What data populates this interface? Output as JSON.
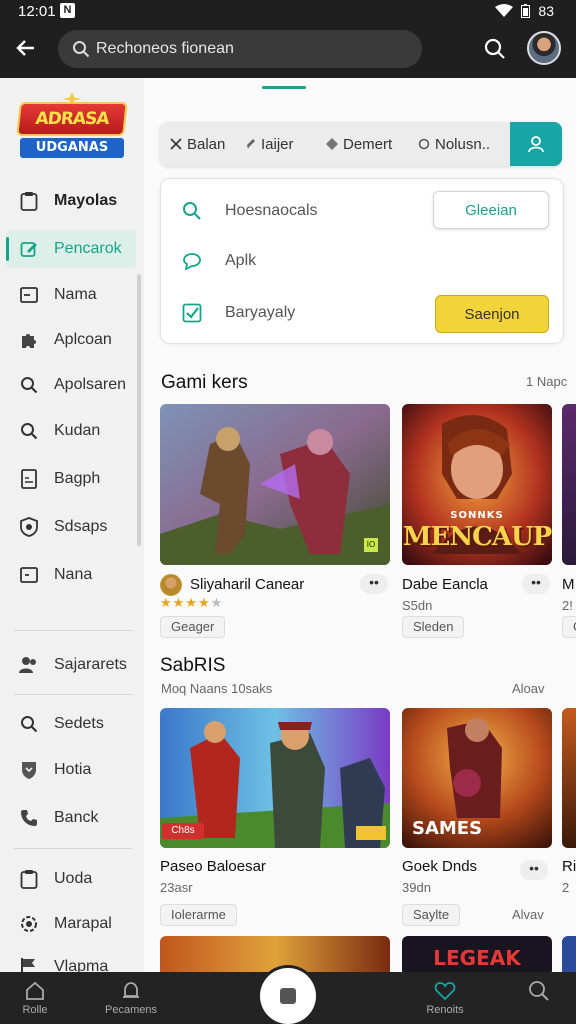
{
  "status_bar": {
    "time": "12:01",
    "notification": "N",
    "battery": "83"
  },
  "search": {
    "value": "Rechoneos fionean"
  },
  "logo": {
    "line1": "ADRASA",
    "line2": "UDGANAS"
  },
  "sidebar": {
    "items": [
      {
        "label": "Mayolas",
        "icon": "clipboard-icon"
      },
      {
        "label": "Pencarok",
        "icon": "edit-icon"
      },
      {
        "label": "Nama",
        "icon": "window-icon"
      },
      {
        "label": "Aplcoan",
        "icon": "puzzle-icon"
      },
      {
        "label": "Apolsaren",
        "icon": "search-icon"
      },
      {
        "label": "Kudan",
        "icon": "search-icon"
      },
      {
        "label": "Bagph",
        "icon": "document-icon"
      },
      {
        "label": "Sdsaps",
        "icon": "shield-icon"
      },
      {
        "label": "Nana",
        "icon": "window-icon"
      },
      {
        "label": "Sajararets",
        "icon": "people-icon"
      },
      {
        "label": "Sedets",
        "icon": "search-icon"
      },
      {
        "label": "Hotia",
        "icon": "badge-icon"
      },
      {
        "label": "Banck",
        "icon": "phone-icon"
      },
      {
        "label": "Uoda",
        "icon": "clipboard-icon"
      },
      {
        "label": "Marapal",
        "icon": "gear-icon"
      },
      {
        "label": "Vlapma",
        "icon": "flag-icon"
      }
    ]
  },
  "filters": {
    "chips": [
      {
        "label": "Balan",
        "icon": "close-icon"
      },
      {
        "label": "Iaijer",
        "icon": "pencil-icon"
      },
      {
        "label": "Demert",
        "icon": "dot-icon"
      },
      {
        "label": "Nolusn..",
        "icon": "circle-icon"
      }
    ],
    "button_icon": "person-icon"
  },
  "panel": {
    "row1": {
      "text": "Hoesnaocals",
      "button": "Gleeian"
    },
    "row2": {
      "text": "Aplk"
    },
    "row3": {
      "text": "Baryayaly",
      "button": "Saenjon"
    }
  },
  "section1": {
    "title": "Gami kers",
    "link": "1 Napc",
    "cards": [
      {
        "title": "Sliyaharil Canear",
        "tag": "Geager",
        "rating": 4,
        "badge": "IO"
      },
      {
        "title": "Dabe Eancla",
        "tag": "Sleden",
        "meta": "S5dn",
        "art_text_1": "SONNKS",
        "art_text_2": "MENCAUP"
      },
      {
        "title": "M",
        "tag": "G",
        "meta": "2!"
      }
    ]
  },
  "section2": {
    "title": "SabRIS",
    "subtitle": "Moq Naans 10saks",
    "link": "Aloav",
    "cards": [
      {
        "title": "Paseo Baloesar",
        "tag": "Iolerarme",
        "meta": "23asr",
        "badge": "Ch8s"
      },
      {
        "title": "Goek Dnds",
        "tag": "Saylte",
        "meta": "39dn",
        "extra": "Alvav",
        "art_text_1": "SAMES"
      },
      {
        "title": "Ri",
        "tag": "",
        "meta": "2"
      }
    ]
  },
  "section3": {
    "art_text": "LEGEAK"
  },
  "bottom_nav": [
    {
      "label": "Rolle",
      "icon": "home-icon"
    },
    {
      "label": "Pecamens",
      "icon": "bell-icon"
    },
    {
      "label": "Renoits",
      "icon": "heart-icon"
    },
    {
      "label": "",
      "icon": "search-icon"
    }
  ],
  "colors": {
    "accent": "#17a589",
    "filter_button": "#17a5a5",
    "yellow_button": "#f2d43a",
    "topbar": "#1f1f1f"
  }
}
